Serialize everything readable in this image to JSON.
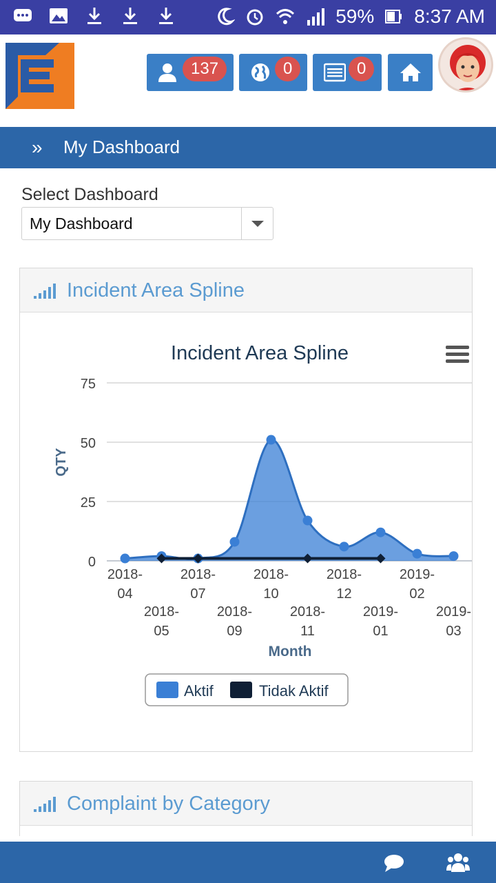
{
  "status_bar": {
    "battery": "59%",
    "time": "8:37 AM",
    "icons": [
      "message-icon",
      "image-icon",
      "download-icon",
      "download-icon",
      "download-icon",
      "moon-icon",
      "alarm-icon",
      "wifi-icon",
      "signal-icon",
      "battery-icon"
    ]
  },
  "header": {
    "users_count": "137",
    "globe_count": "0",
    "list_count": "0",
    "colors": {
      "button": "#3a7fc6",
      "badge": "#d9534f"
    }
  },
  "breadcrumb": {
    "title": "My Dashboard"
  },
  "selector": {
    "label": "Select Dashboard",
    "value": "My Dashboard"
  },
  "panels": [
    {
      "title": "Incident Area Spline"
    },
    {
      "title": "Complaint by Category"
    }
  ],
  "chart_data": {
    "type": "area",
    "title": "Incident Area Spline",
    "xlabel": "Month",
    "ylabel": "QTY",
    "ylim": [
      0,
      75
    ],
    "yticks": [
      "0",
      "25",
      "50",
      "75"
    ],
    "categories": [
      "2018-04",
      "2018-05",
      "2018-07",
      "2018-09",
      "2018-10",
      "2018-11",
      "2018-12",
      "2019-01",
      "2019-02",
      "2019-03"
    ],
    "category_lines": [
      [
        "2018-",
        "04"
      ],
      [
        "2018-",
        "05"
      ],
      [
        "2018-",
        "07"
      ],
      [
        "2018-",
        "09"
      ],
      [
        "2018-",
        "10"
      ],
      [
        "2018-",
        "11"
      ],
      [
        "2018-",
        "12"
      ],
      [
        "2019-",
        "01"
      ],
      [
        "2019-",
        "02"
      ],
      [
        "2019-",
        "03"
      ]
    ],
    "series": [
      {
        "name": "Aktif",
        "color": "#3a7fd5",
        "values": [
          1,
          2,
          1,
          8,
          51,
          17,
          6,
          12,
          3,
          2
        ]
      },
      {
        "name": "Tidak Aktif",
        "color": "#0f1f35",
        "values": [
          null,
          1,
          1,
          null,
          null,
          1,
          null,
          1,
          null,
          null
        ]
      }
    ],
    "legend": "bottom-center",
    "grid": true
  }
}
